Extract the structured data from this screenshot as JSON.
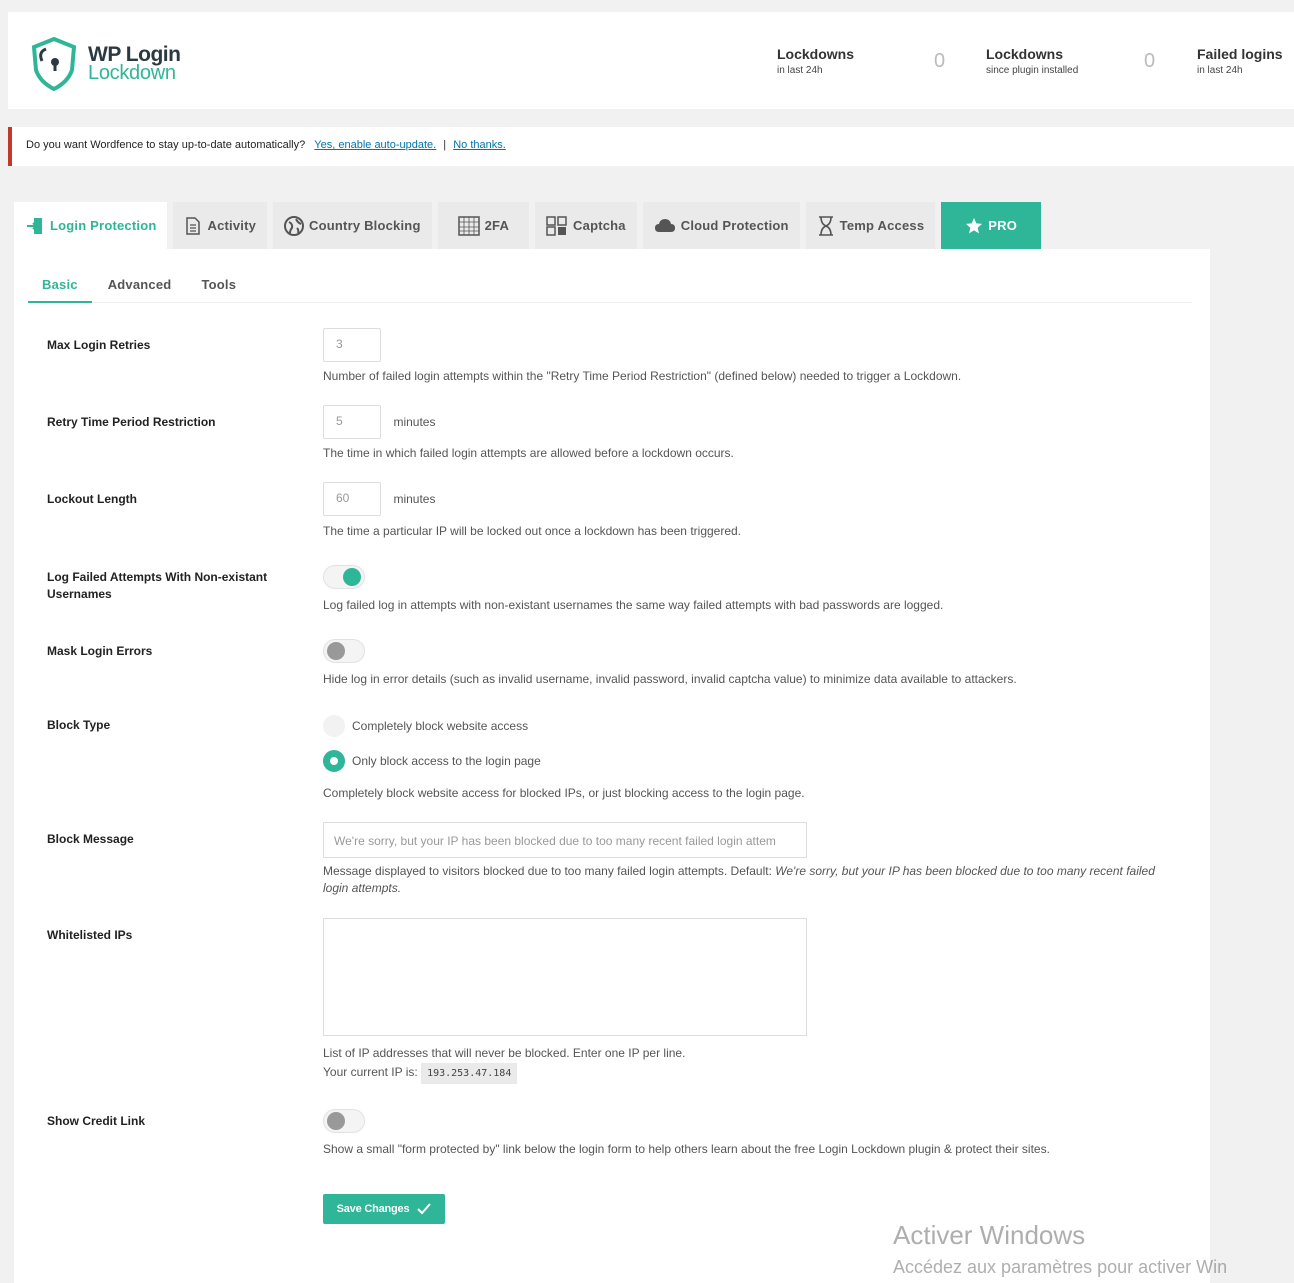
{
  "brand": {
    "line1": "WP Login",
    "line2": "Lockdown",
    "accent": "#2fb598"
  },
  "stats": [
    {
      "label": "Lockdowns",
      "sub": "in last 24h",
      "value": "0"
    },
    {
      "label": "Lockdowns",
      "sub": "since plugin installed",
      "value": "0"
    },
    {
      "label": "Failed logins",
      "sub": "in last 24h"
    }
  ],
  "notice": {
    "text": "Do you want Wordfence to stay up-to-date automatically?",
    "link_yes": "Yes, enable auto-update.",
    "separator": "|",
    "link_no": "No thanks."
  },
  "tabs": [
    {
      "label": "Login Protection",
      "icon": "login-icon"
    },
    {
      "label": "Activity",
      "icon": "document-icon"
    },
    {
      "label": "Country Blocking",
      "icon": "globe-icon"
    },
    {
      "label": "2FA",
      "icon": "grid-icon"
    },
    {
      "label": "Captcha",
      "icon": "captcha-icon"
    },
    {
      "label": "Cloud Protection",
      "icon": "cloud-icon"
    },
    {
      "label": "Temp Access",
      "icon": "hourglass-icon"
    },
    {
      "label": "PRO",
      "icon": "star-icon"
    }
  ],
  "subtabs": [
    "Basic",
    "Advanced",
    "Tools"
  ],
  "fields": {
    "max_retries": {
      "label": "Max Login Retries",
      "value": "3",
      "help": "Number of failed login attempts within the \"Retry Time Period Restriction\" (defined below) needed to trigger a Lockdown."
    },
    "retry_period": {
      "label": "Retry Time Period Restriction",
      "value": "5",
      "unit": "minutes",
      "help": "The time in which failed login attempts are allowed before a lockdown occurs."
    },
    "lockout_length": {
      "label": "Lockout Length",
      "value": "60",
      "unit": "minutes",
      "help": "The time a particular IP will be locked out once a lockdown has been triggered."
    },
    "log_nonexistant": {
      "label": "Log Failed Attempts With Non-existant Usernames",
      "enabled": true,
      "help": "Log failed log in attempts with non-existant usernames the same way failed attempts with bad passwords are logged."
    },
    "mask_errors": {
      "label": "Mask Login Errors",
      "enabled": false,
      "help": "Hide log in error details (such as invalid username, invalid password, invalid captcha value) to minimize data available to attackers."
    },
    "block_type": {
      "label": "Block Type",
      "option1": "Completely block website access",
      "option2": "Only block access to the login page",
      "selected": "Only block access to the login page",
      "help": "Completely block website access for blocked IPs, or just blocking access to the login page."
    },
    "block_message": {
      "label": "Block Message",
      "value": "We're sorry, but your IP has been blocked due to too many recent failed login attem",
      "help_prefix": "Message displayed to visitors blocked due to too many failed login attempts. Default:",
      "help_default": "We're sorry, but your IP has been blocked due to too many recent failed login attempts."
    },
    "whitelist": {
      "label": "Whitelisted IPs",
      "value": "",
      "help": "List of IP addresses that will never be blocked. Enter one IP per line.",
      "ip_prefix": "Your current IP is:",
      "ip": "193.253.47.184"
    },
    "credit_link": {
      "label": "Show Credit Link",
      "enabled": false,
      "help": "Show a small \"form protected by\" link below the login form to help others learn about the free Login Lockdown plugin & protect their sites."
    }
  },
  "save_label": "Save Changes",
  "watermark": {
    "line1": "Activer Windows",
    "line2": "Accédez aux paramètres pour activer Win"
  }
}
